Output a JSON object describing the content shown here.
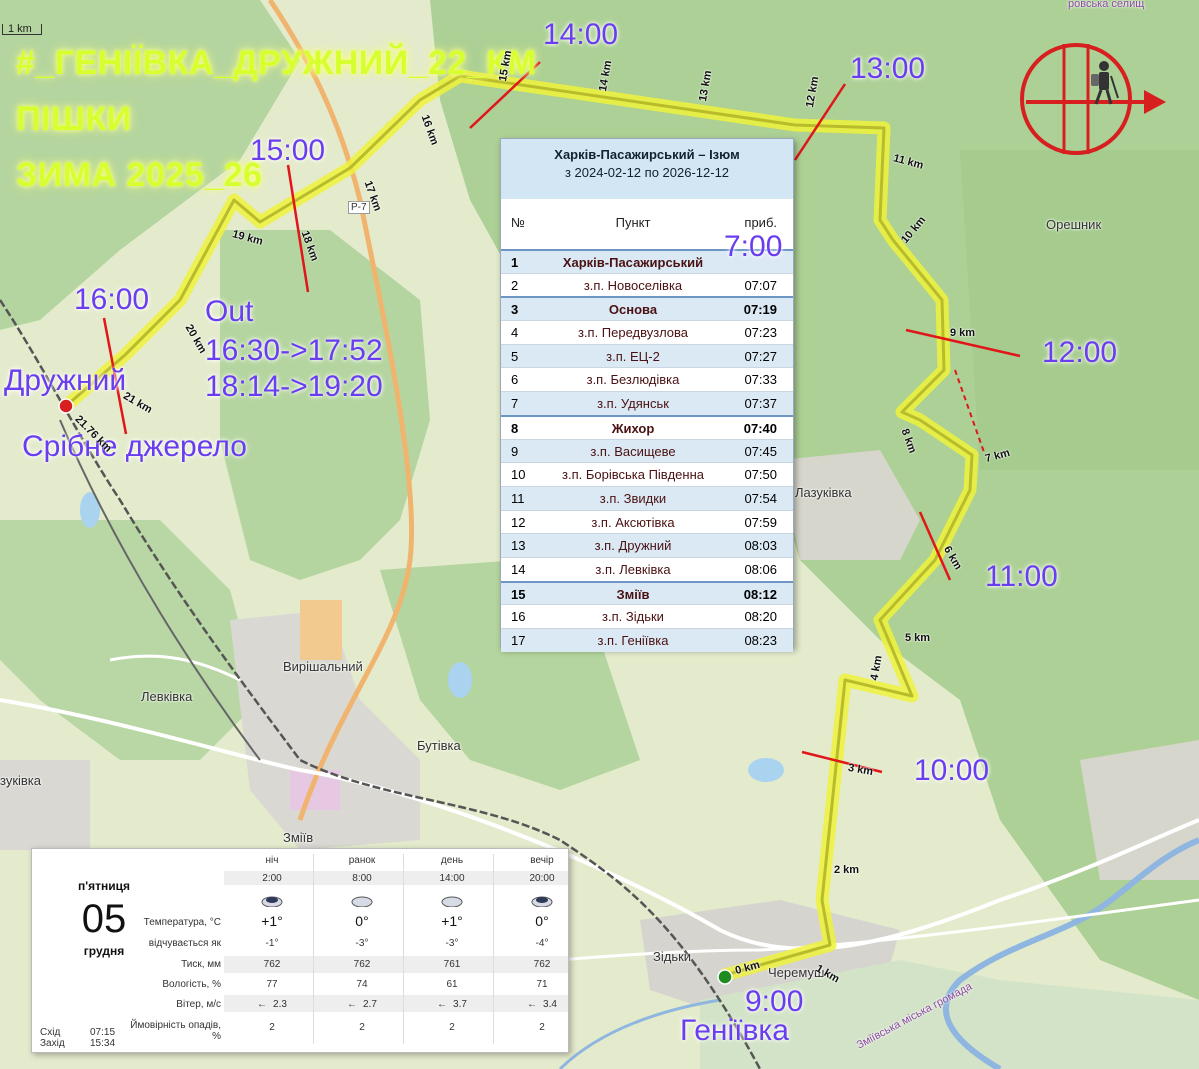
{
  "title": {
    "line1": "#_ГЕНІЇВКА_ДРУЖНИЙ_22_КМ",
    "line2": "ПІШКИ",
    "line3": "ЗИМА 2025_26"
  },
  "scale_label": "1 km",
  "time_marks": {
    "t0900": "9:00",
    "t1000": "10:00",
    "t1100": "11:00",
    "t1200": "12:00",
    "t1300": "13:00",
    "t1400": "14:00",
    "t1500": "15:00",
    "t1600": "16:00"
  },
  "out_block": {
    "l1": "Out",
    "l2": "16:30->17:52",
    "l3": "18:14->19:20"
  },
  "places": {
    "start": "Геніївка",
    "end": "Дружний",
    "spring": "Срібне джерело"
  },
  "towns": {
    "oreshnyk": "Орешник",
    "lazukivka": "Лазуківка",
    "vyrishalnyi": "Вирішальний",
    "levkivka": "Левківка",
    "butivka": "Бутівка",
    "zmiiv": "Зміїв",
    "zidky": "Зідьки",
    "cheremushne": "Черемуш",
    "zukivka": "зуківка",
    "road": "Р-7",
    "gromada": "Зміївська міська громада",
    "selyshche": "ровська селищ"
  },
  "km_labels": [
    "0 km",
    "1 km",
    "2 km",
    "3 km",
    "4 km",
    "5 km",
    "6 km",
    "7 km",
    "8 km",
    "9 km",
    "10 km",
    "11 km",
    "12 km",
    "13 km",
    "14 km",
    "15 km",
    "16 km",
    "17 km",
    "18 km",
    "19 km",
    "20 km",
    "21 km",
    "21.76 km"
  ],
  "schedule": {
    "route": "Харків-Пасажирський – Ізюм",
    "period": "з 2024-02-12 по 2026-12-12",
    "col_no": "№",
    "col_stop": "Пункт",
    "col_time": "приб.",
    "first_time_override": "7:00",
    "rows": [
      {
        "no": "1",
        "stop": "Харків-Пасажирський",
        "time": "",
        "major": true
      },
      {
        "no": "2",
        "stop": "з.п. Новоселівка",
        "time": "07:07",
        "major": false
      },
      {
        "no": "3",
        "stop": "Основа",
        "time": "07:19",
        "major": true
      },
      {
        "no": "4",
        "stop": "з.п. Передвузлова",
        "time": "07:23",
        "major": false
      },
      {
        "no": "5",
        "stop": "з.п. ЕЦ-2",
        "time": "07:27",
        "major": false
      },
      {
        "no": "6",
        "stop": "з.п. Безлюдівка",
        "time": "07:33",
        "major": false
      },
      {
        "no": "7",
        "stop": "з.п. Удянськ",
        "time": "07:37",
        "major": false
      },
      {
        "no": "8",
        "stop": "Жихор",
        "time": "07:40",
        "major": true
      },
      {
        "no": "9",
        "stop": "з.п. Васищеве",
        "time": "07:45",
        "major": false
      },
      {
        "no": "10",
        "stop": "з.п. Борівська Південна",
        "time": "07:50",
        "major": false
      },
      {
        "no": "11",
        "stop": "з.п. Звидки",
        "time": "07:54",
        "major": false
      },
      {
        "no": "12",
        "stop": "з.п. Аксютівка",
        "time": "07:59",
        "major": false
      },
      {
        "no": "13",
        "stop": "з.п. Дружний",
        "time": "08:03",
        "major": false
      },
      {
        "no": "14",
        "stop": "з.п. Левківка",
        "time": "08:06",
        "major": false
      },
      {
        "no": "15",
        "stop": "Зміїв",
        "time": "08:12",
        "major": true
      },
      {
        "no": "16",
        "stop": "з.п. Зідьки",
        "time": "08:20",
        "major": false
      },
      {
        "no": "17",
        "stop": "з.п. Геніївка",
        "time": "08:23",
        "major": false
      }
    ]
  },
  "weather": {
    "dow": "п'ятниця",
    "day": "05",
    "month": "грудня",
    "periods": [
      "ніч",
      "ранок",
      "день",
      "вечір"
    ],
    "times": [
      "2:00",
      "8:00",
      "14:00",
      "20:00"
    ],
    "labels": {
      "temp": "Температура, °C",
      "feels": "відчувається як",
      "pressure": "Тиск, мм",
      "humidity": "Вологість, %",
      "wind": "Вітер, м/с",
      "precip": "Ймовірність опадів, %"
    },
    "temp": [
      "+1°",
      "0°",
      "+1°",
      "0°"
    ],
    "feels": [
      "-1°",
      "-3°",
      "-3°",
      "-4°"
    ],
    "pressure": [
      "762",
      "762",
      "761",
      "762"
    ],
    "humidity": [
      "77",
      "74",
      "61",
      "71"
    ],
    "wind": [
      "2.3",
      "2.7",
      "3.7",
      "3.4"
    ],
    "wind_arrow": "←",
    "precip": [
      "2",
      "2",
      "2",
      "2"
    ],
    "sunrise_label": "Схід",
    "sunrise": "07:15",
    "sunset_label": "Захід",
    "sunset": "15:34"
  },
  "colors": {
    "route": "#f0f23a",
    "time_text": "#6a3df0",
    "marker_line": "#e0161b",
    "start_dot": "#1f8a1f",
    "end_dot": "#d81f1f",
    "forest": "#aed09a",
    "meadow": "#e6ecc8"
  }
}
